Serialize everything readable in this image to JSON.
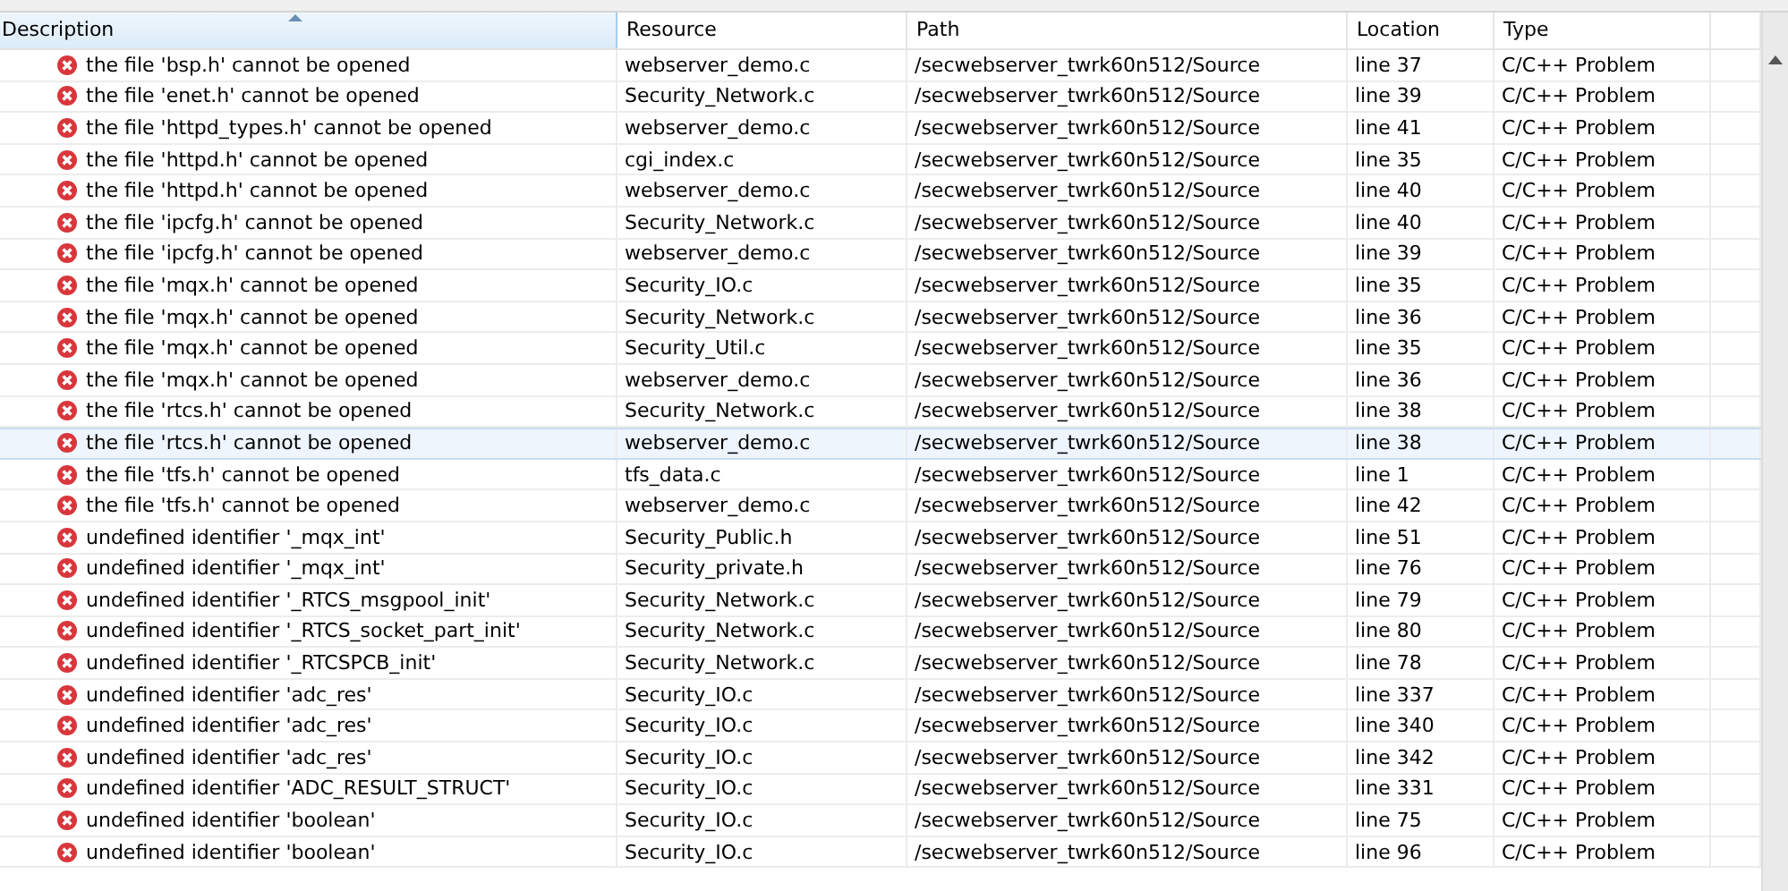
{
  "table": {
    "columns": [
      {
        "label": "Description",
        "sorted": true
      },
      {
        "label": "Resource",
        "sorted": false
      },
      {
        "label": "Path",
        "sorted": false
      },
      {
        "label": "Location",
        "sorted": false
      },
      {
        "label": "Type",
        "sorted": false
      }
    ],
    "rows": [
      {
        "selected": false,
        "cells": [
          "the file 'bsp.h' cannot be opened",
          "webserver_demo.c",
          "/secwebserver_twrk60n512/Source",
          "line 37",
          "C/C++ Problem"
        ]
      },
      {
        "selected": false,
        "cells": [
          "the file 'enet.h' cannot be opened",
          "Security_Network.c",
          "/secwebserver_twrk60n512/Source",
          "line 39",
          "C/C++ Problem"
        ]
      },
      {
        "selected": false,
        "cells": [
          "the file 'httpd_types.h' cannot be opened",
          "webserver_demo.c",
          "/secwebserver_twrk60n512/Source",
          "line 41",
          "C/C++ Problem"
        ]
      },
      {
        "selected": false,
        "cells": [
          "the file 'httpd.h' cannot be opened",
          "cgi_index.c",
          "/secwebserver_twrk60n512/Source",
          "line 35",
          "C/C++ Problem"
        ]
      },
      {
        "selected": false,
        "cells": [
          "the file 'httpd.h' cannot be opened",
          "webserver_demo.c",
          "/secwebserver_twrk60n512/Source",
          "line 40",
          "C/C++ Problem"
        ]
      },
      {
        "selected": false,
        "cells": [
          "the file 'ipcfg.h' cannot be opened",
          "Security_Network.c",
          "/secwebserver_twrk60n512/Source",
          "line 40",
          "C/C++ Problem"
        ]
      },
      {
        "selected": false,
        "cells": [
          "the file 'ipcfg.h' cannot be opened",
          "webserver_demo.c",
          "/secwebserver_twrk60n512/Source",
          "line 39",
          "C/C++ Problem"
        ]
      },
      {
        "selected": false,
        "cells": [
          "the file 'mqx.h' cannot be opened",
          "Security_IO.c",
          "/secwebserver_twrk60n512/Source",
          "line 35",
          "C/C++ Problem"
        ]
      },
      {
        "selected": false,
        "cells": [
          "the file 'mqx.h' cannot be opened",
          "Security_Network.c",
          "/secwebserver_twrk60n512/Source",
          "line 36",
          "C/C++ Problem"
        ]
      },
      {
        "selected": false,
        "cells": [
          "the file 'mqx.h' cannot be opened",
          "Security_Util.c",
          "/secwebserver_twrk60n512/Source",
          "line 35",
          "C/C++ Problem"
        ]
      },
      {
        "selected": false,
        "cells": [
          "the file 'mqx.h' cannot be opened",
          "webserver_demo.c",
          "/secwebserver_twrk60n512/Source",
          "line 36",
          "C/C++ Problem"
        ]
      },
      {
        "selected": false,
        "cells": [
          "the file 'rtcs.h' cannot be opened",
          "Security_Network.c",
          "/secwebserver_twrk60n512/Source",
          "line 38",
          "C/C++ Problem"
        ]
      },
      {
        "selected": true,
        "cells": [
          "the file 'rtcs.h' cannot be opened",
          "webserver_demo.c",
          "/secwebserver_twrk60n512/Source",
          "line 38",
          "C/C++ Problem"
        ]
      },
      {
        "selected": false,
        "cells": [
          "the file 'tfs.h' cannot be opened",
          "tfs_data.c",
          "/secwebserver_twrk60n512/Source",
          "line 1",
          "C/C++ Problem"
        ]
      },
      {
        "selected": false,
        "cells": [
          "the file 'tfs.h' cannot be opened",
          "webserver_demo.c",
          "/secwebserver_twrk60n512/Source",
          "line 42",
          "C/C++ Problem"
        ]
      },
      {
        "selected": false,
        "cells": [
          "undefined identifier '_mqx_int'",
          "Security_Public.h",
          "/secwebserver_twrk60n512/Source",
          "line 51",
          "C/C++ Problem"
        ]
      },
      {
        "selected": false,
        "cells": [
          "undefined identifier '_mqx_int'",
          "Security_private.h",
          "/secwebserver_twrk60n512/Source",
          "line 76",
          "C/C++ Problem"
        ]
      },
      {
        "selected": false,
        "cells": [
          "undefined identifier '_RTCS_msgpool_init'",
          "Security_Network.c",
          "/secwebserver_twrk60n512/Source",
          "line 79",
          "C/C++ Problem"
        ]
      },
      {
        "selected": false,
        "cells": [
          "undefined identifier '_RTCS_socket_part_init'",
          "Security_Network.c",
          "/secwebserver_twrk60n512/Source",
          "line 80",
          "C/C++ Problem"
        ]
      },
      {
        "selected": false,
        "cells": [
          "undefined identifier '_RTCSPCB_init'",
          "Security_Network.c",
          "/secwebserver_twrk60n512/Source",
          "line 78",
          "C/C++ Problem"
        ]
      },
      {
        "selected": false,
        "cells": [
          "undefined identifier 'adc_res'",
          "Security_IO.c",
          "/secwebserver_twrk60n512/Source",
          "line 337",
          "C/C++ Problem"
        ]
      },
      {
        "selected": false,
        "cells": [
          "undefined identifier 'adc_res'",
          "Security_IO.c",
          "/secwebserver_twrk60n512/Source",
          "line 340",
          "C/C++ Problem"
        ]
      },
      {
        "selected": false,
        "cells": [
          "undefined identifier 'adc_res'",
          "Security_IO.c",
          "/secwebserver_twrk60n512/Source",
          "line 342",
          "C/C++ Problem"
        ]
      },
      {
        "selected": false,
        "cells": [
          "undefined identifier 'ADC_RESULT_STRUCT'",
          "Security_IO.c",
          "/secwebserver_twrk60n512/Source",
          "line 331",
          "C/C++ Problem"
        ]
      },
      {
        "selected": false,
        "cells": [
          "undefined identifier 'boolean'",
          "Security_IO.c",
          "/secwebserver_twrk60n512/Source",
          "line 75",
          "C/C++ Problem"
        ]
      },
      {
        "selected": false,
        "cells": [
          "undefined identifier 'boolean'",
          "Security_IO.c",
          "/secwebserver_twrk60n512/Source",
          "line 96",
          "C/C++ Problem"
        ]
      }
    ]
  }
}
